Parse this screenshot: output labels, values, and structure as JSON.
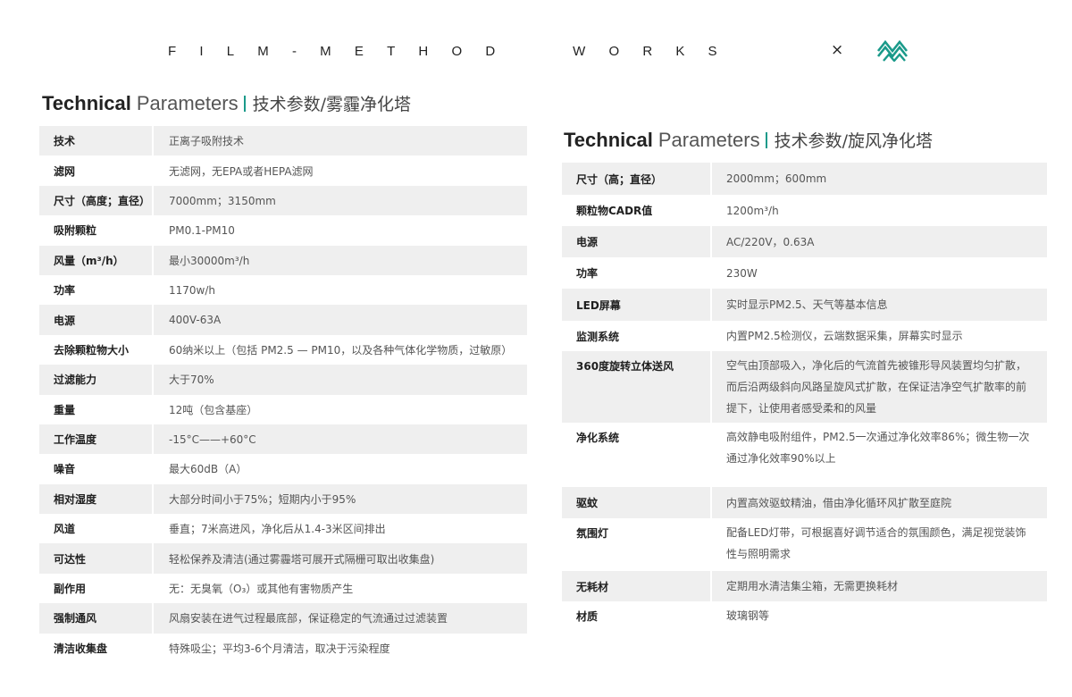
{
  "brand": {
    "text": "FILM-METHOD  WORKS",
    "separator": "×",
    "logo_icon": "mountain-zigzag-logo",
    "logo_color": "#1a9a8a"
  },
  "left": {
    "title_bold": "Technical",
    "title_light": "Parameters",
    "title_cn": "技术参数/雾霾净化塔",
    "rows": [
      {
        "key": "技术",
        "value": "正离子吸附技术"
      },
      {
        "key": "滤网",
        "value": "无滤网，无EPA或者HEPA滤网"
      },
      {
        "key": "尺寸（高度；直径）",
        "value": "7000mm；3150mm"
      },
      {
        "key": "吸附颗粒",
        "value": "PM0.1-PM10"
      },
      {
        "key": "风量（m³/h）",
        "value": "最小30000m³/h"
      },
      {
        "key": "功率",
        "value": "1170w/h"
      },
      {
        "key": "电源",
        "value": "400V-63A"
      },
      {
        "key": "去除颗粒物大小",
        "value": "60纳米以上（包括 PM2.5 — PM10，以及各种气体化学物质，过敏原）"
      },
      {
        "key": "过滤能力",
        "value": "大于70%"
      },
      {
        "key": "重量",
        "value": "12吨（包含基座）"
      },
      {
        "key": "工作温度",
        "value": "-15°C——+60°C"
      },
      {
        "key": "噪音",
        "value": "最大60dB（A）"
      },
      {
        "key": "相对湿度",
        "value": "大部分时间小于75%；短期内小于95%"
      },
      {
        "key": "风道",
        "value": "垂直；7米高进风，净化后从1.4-3米区间排出"
      },
      {
        "key": "可达性",
        "value": "轻松保养及清洁(通过雾霾塔可展开式隔栅可取出收集盘)"
      },
      {
        "key": "副作用",
        "value": "无：无臭氧（O₃）或其他有害物质产生"
      },
      {
        "key": "强制通风",
        "value": "风扇安装在进气过程最底部，保证稳定的气流通过过滤装置"
      },
      {
        "key": "清洁收集盘",
        "value": "特殊吸尘；平均3-6个月清洁，取决于污染程度"
      }
    ]
  },
  "right": {
    "title_bold": "Technical",
    "title_light": "Parameters",
    "title_cn": "技术参数/旋风净化塔",
    "rows": [
      {
        "key": "尺寸（高；直径）",
        "value": "2000mm；600mm"
      },
      {
        "key": "颗粒物CADR值",
        "value": "1200m³/h"
      },
      {
        "key": "电源",
        "value": "AC/220V，0.63A"
      },
      {
        "key": "功率",
        "value": "230W"
      },
      {
        "key": "LED屏幕",
        "value": "实时显示PM2.5、天气等基本信息"
      },
      {
        "key": "监测系统",
        "value": "内置PM2.5检测仪，云端数据采集，屏幕实时显示"
      },
      {
        "key": "360度旋转立体送风",
        "value": "空气由顶部吸入，净化后的气流首先被锥形导风装置均匀扩散，而后沿两级斜向风路呈旋风式扩散，在保证洁净空气扩散率的前提下，让使用者感受柔和的风量"
      },
      {
        "key": "净化系统",
        "value": "高效静电吸附组件，PM2.5一次通过净化效率86%；微生物一次通过净化效率90%以上"
      },
      {
        "key": "驱蚊",
        "value": "内置高效驱蚊精油，借由净化循环风扩散至庭院"
      },
      {
        "key": "氛围灯",
        "value": "配备LED灯带，可根据喜好调节适合的氛围颜色，满足视觉装饰性与照明需求"
      },
      {
        "key": "无耗材",
        "value": "定期用水清洁集尘箱，无需更换耗材"
      },
      {
        "key": "材质",
        "value": "玻璃钢等"
      }
    ]
  }
}
